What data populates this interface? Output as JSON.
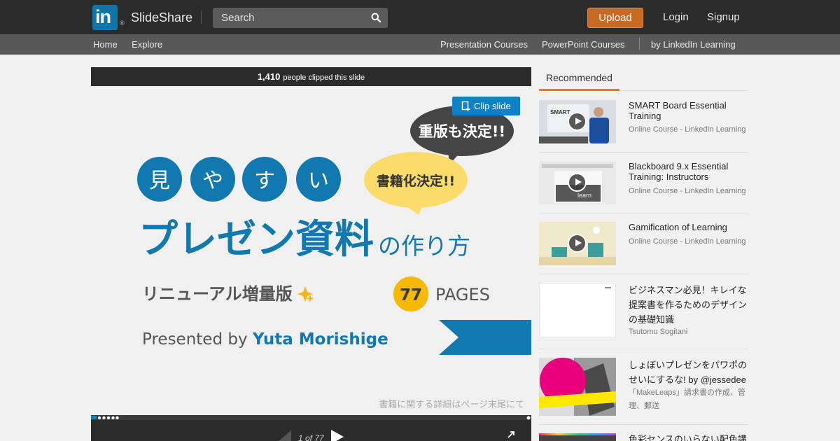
{
  "header": {
    "logo_text": "in",
    "registered": "®",
    "brand": "SlideShare",
    "search_placeholder": "Search",
    "upload_label": "Upload",
    "login_label": "Login",
    "signup_label": "Signup"
  },
  "subnav": {
    "home": "Home",
    "explore": "Explore",
    "presentation_courses": "Presentation Courses",
    "powerpoint_courses": "PowerPoint Courses",
    "linkedin_learning": "by LinkedIn Learning"
  },
  "slide_panel": {
    "clip_count": "1,410",
    "clip_text": "people clipped this slide",
    "clip_button": "Clip slide",
    "page_indicator": "1 of 77",
    "progress_fraction": 0.013
  },
  "slide": {
    "bubble_dark": "重版も決定!!",
    "bubble_yellow": "書籍化決定!!",
    "circles": [
      "見",
      "や",
      "す",
      "い"
    ],
    "title_main": "プレゼン資料",
    "title_suffix": "の作り方",
    "subtitle": "リニューアル増量版",
    "pages_number": "77",
    "pages_label": "PAGES",
    "presented_by": "Presented by ",
    "author": "Yuta Morishige",
    "footnote": "書籍に関する詳細はページ末尾にて"
  },
  "recommended": {
    "tab_label": "Recommended",
    "items": [
      {
        "title": "SMART Board Essential Training",
        "subtitle": "Online Course - LinkedIn Learning",
        "video": true
      },
      {
        "title": "Blackboard 9.x Essential Training: Instructors",
        "subtitle": "Online Course - LinkedIn Learning",
        "video": true
      },
      {
        "title": "Gamification of Learning",
        "subtitle": "Online Course - LinkedIn Learning",
        "video": true
      },
      {
        "title": "ビジネスマン必見！キレイな提案書を作るためのデザインの基礎知識",
        "subtitle": "Tsutomu Sogitani",
        "video": false
      },
      {
        "title": "しょぼいプレゼンをパワポのせいにするな! by @jessedee",
        "subtitle": "「MakeLeaps」請求書の作成、管理、郵送",
        "video": false
      },
      {
        "title": "色彩センスのいらない配色講座",
        "subtitle": "",
        "video": false
      }
    ]
  },
  "colors": {
    "accent_orange": "#c96a24",
    "tab_orange": "#e07b39",
    "clip_blue": "#0f81c8",
    "slide_blue": "#1179b0",
    "header_bg": "#2b2b2b"
  }
}
